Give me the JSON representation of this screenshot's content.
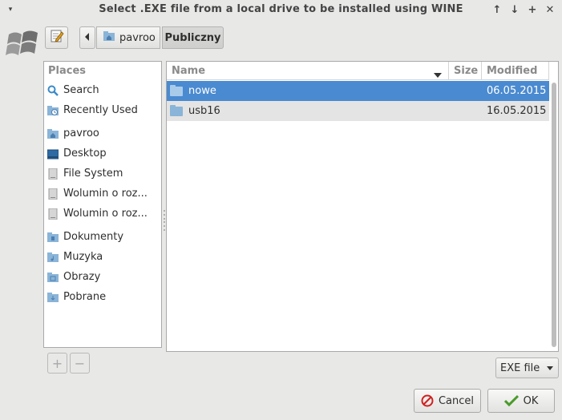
{
  "window": {
    "title": "Select .EXE file from a local drive to be installed using WINE",
    "menu_glyph": "▾",
    "buttons": {
      "up": "↑",
      "down": "↓",
      "maximize": "+",
      "close": "✕"
    }
  },
  "toolbar": {
    "breadcrumb": [
      {
        "label": "pavroo",
        "icon": "home-folder-icon"
      },
      {
        "label": "Publiczny",
        "active": true
      }
    ]
  },
  "places": {
    "header": "Places",
    "items": [
      {
        "label": "Search",
        "icon": "search-icon"
      },
      {
        "label": "Recently Used",
        "icon": "recent-folder-icon"
      },
      {
        "label": "pavroo",
        "icon": "home-folder-icon"
      },
      {
        "label": "Desktop",
        "icon": "desktop-icon"
      },
      {
        "label": "File System",
        "icon": "drive-icon"
      },
      {
        "label": "Wolumin o roz...",
        "icon": "drive-icon"
      },
      {
        "label": "Wolumin o roz...",
        "icon": "drive-icon"
      },
      {
        "label": "Dokumenty",
        "icon": "documents-folder-icon"
      },
      {
        "label": "Muzyka",
        "icon": "music-folder-icon"
      },
      {
        "label": "Obrazy",
        "icon": "pictures-folder-icon"
      },
      {
        "label": "Pobrane",
        "icon": "downloads-folder-icon"
      }
    ],
    "add_label": "+",
    "remove_label": "−"
  },
  "files": {
    "columns": {
      "name": "Name",
      "size": "Size",
      "modified": "Modified"
    },
    "rows": [
      {
        "name": "nowe",
        "size": "",
        "modified": "06.05.2015",
        "selected": true
      },
      {
        "name": "usb16",
        "size": "",
        "modified": "16.05.2015",
        "selected": false
      }
    ]
  },
  "filter": {
    "selected": "EXE file"
  },
  "actions": {
    "cancel": "Cancel",
    "ok": "OK"
  },
  "colors": {
    "selection": "#4a8ad0",
    "folder": "#8ab4d8"
  }
}
